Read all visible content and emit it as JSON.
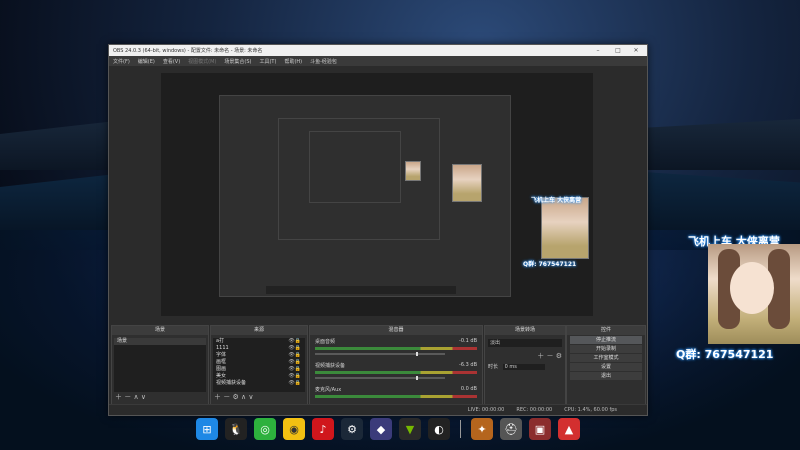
{
  "window": {
    "title": "OBS 24.0.3 (64-bit, windows) - 配置文件: 未命名 - 场景: 未命名",
    "menu": [
      "文件(F)",
      "编辑(E)",
      "查看(V)",
      "视图模式(M)",
      "场景集合(S)",
      "工具(T)",
      "帮助(H)",
      "斗鱼-经验包"
    ]
  },
  "overlay": {
    "banner": "飞机上车 大侠离营",
    "qq": "Q群: 767547121"
  },
  "docks": {
    "scenes": {
      "title": "场景",
      "items": [
        "场景"
      ]
    },
    "sources": {
      "title": "来源",
      "items": [
        "a打",
        "1111",
        "字体",
        "画框",
        "图画",
        "美女",
        "视频捕获设备"
      ]
    },
    "mixer": {
      "title": "混音器",
      "tracks": [
        {
          "name": "桌面音频",
          "db": "-0.1 dB"
        },
        {
          "name": "视频捕获设备",
          "db": "-6.3 dB"
        },
        {
          "name": "麦克风/Aux",
          "db": "0.0 dB"
        }
      ]
    },
    "transitions": {
      "title": "场景转场",
      "mode": "淡出",
      "duration_label": "时长",
      "duration": "0 ms"
    },
    "controls": {
      "title": "控件",
      "buttons": [
        "停止推流",
        "开始录制",
        "工作室模式",
        "设置",
        "退出"
      ]
    }
  },
  "status": {
    "live": "LIVE: 00:00:00",
    "rec": "REC: 00:00:00",
    "cpu": "CPU: 1.4%, 60.00 fps"
  },
  "taskbar_icons": [
    "windows-icon",
    "qq-icon",
    "wechat-icon",
    "browser-icon",
    "netease-music-icon",
    "steam-icon",
    "game-icon",
    "nvidia-icon",
    "obs-icon",
    "game2-icon",
    "pubg-icon",
    "game3-icon",
    "game4-icon"
  ]
}
